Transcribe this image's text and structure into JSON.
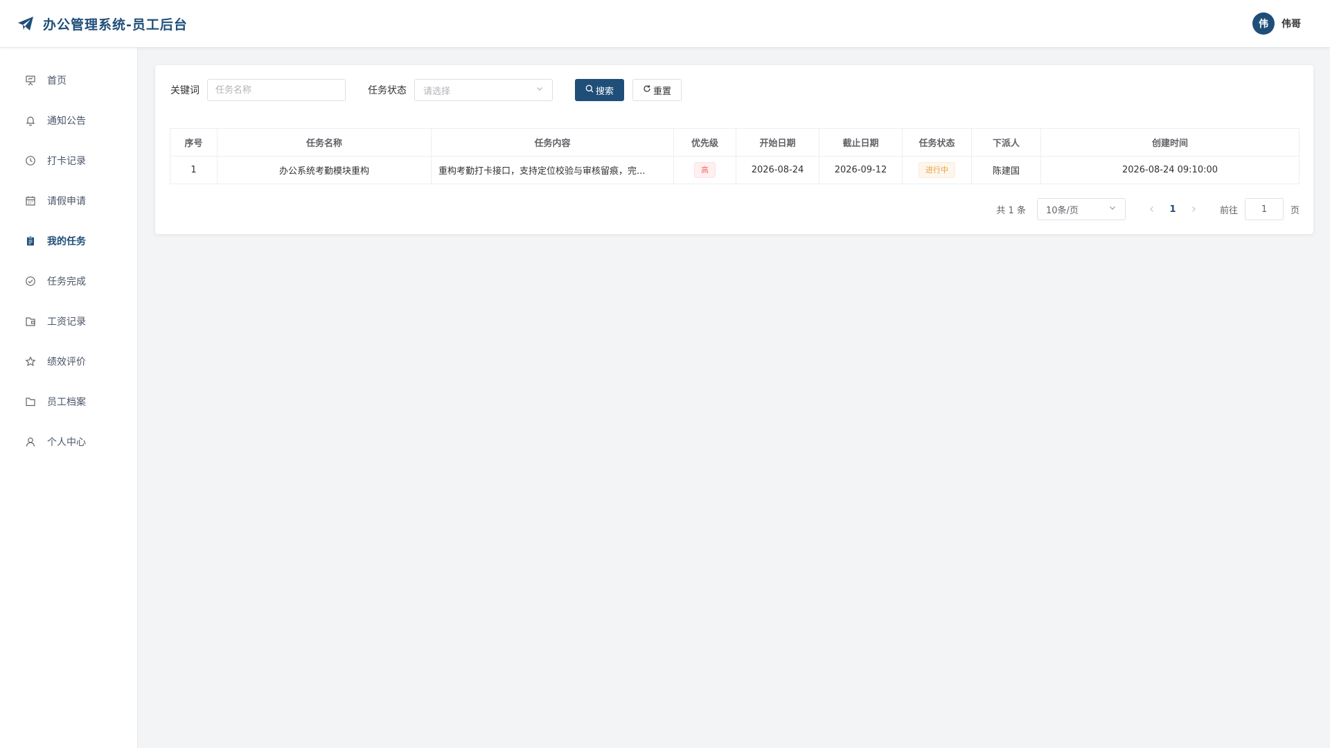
{
  "header": {
    "title": "办公管理系统-员工后台",
    "avatar_text": "伟",
    "user_name": "伟哥"
  },
  "sidebar": {
    "items": [
      {
        "label": "首页",
        "icon": "presentation-icon",
        "active": false
      },
      {
        "label": "通知公告",
        "icon": "bell-icon",
        "active": false
      },
      {
        "label": "打卡记录",
        "icon": "clock-icon",
        "active": false
      },
      {
        "label": "请假申请",
        "icon": "calendar-icon",
        "active": false
      },
      {
        "label": "我的任务",
        "icon": "clipboard-icon",
        "active": true
      },
      {
        "label": "任务完成",
        "icon": "check-circle-icon",
        "active": false
      },
      {
        "label": "工资记录",
        "icon": "wallet-icon",
        "active": false
      },
      {
        "label": "绩效评价",
        "icon": "star-icon",
        "active": false
      },
      {
        "label": "员工档案",
        "icon": "folder-icon",
        "active": false
      },
      {
        "label": "个人中心",
        "icon": "user-icon",
        "active": false
      }
    ]
  },
  "filters": {
    "keyword_label": "关键词",
    "keyword_placeholder": "任务名称",
    "keyword_value": "",
    "status_label": "任务状态",
    "status_placeholder": "请选择",
    "search_label": "搜索",
    "reset_label": "重置"
  },
  "table": {
    "columns": [
      "序号",
      "任务名称",
      "任务内容",
      "优先级",
      "开始日期",
      "截止日期",
      "任务状态",
      "下派人",
      "创建时间"
    ],
    "rows": [
      {
        "index": "1",
        "name": "办公系统考勤模块重构",
        "content": "重构考勤打卡接口，支持定位校验与审核留痕，完...",
        "priority": "高",
        "start_date": "2026-08-24",
        "end_date": "2026-09-12",
        "status": "进行中",
        "assigner": "陈建国",
        "created_at": "2026-08-24 09:10:00"
      }
    ]
  },
  "pagination": {
    "total_text": "共 1 条",
    "page_size": "10条/页",
    "current_page": "1",
    "goto_label": "前往",
    "goto_value": "1",
    "page_suffix": "页"
  },
  "colors": {
    "brand": "#1f4e79",
    "priority_high": "#f56c6c",
    "status_in_progress": "#e6a23c"
  }
}
